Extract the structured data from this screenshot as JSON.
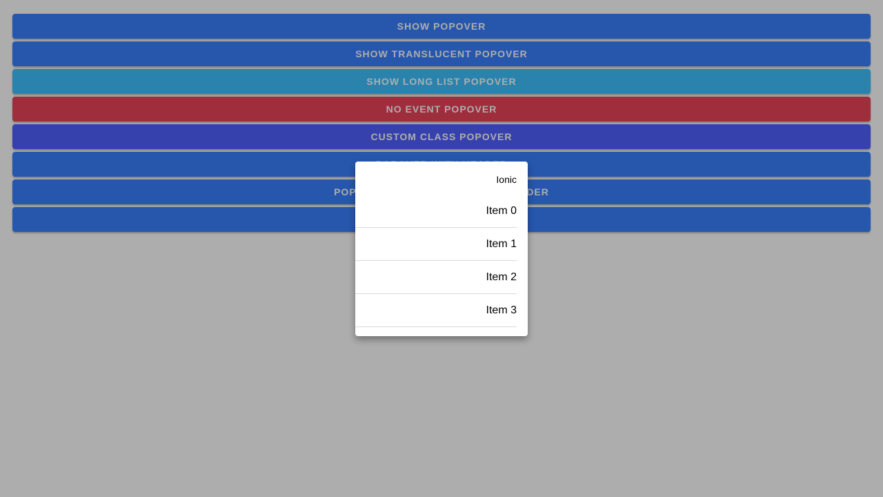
{
  "buttons": [
    {
      "label": "Show Popover",
      "color": "#3880ff"
    },
    {
      "label": "Show Translucent Popover",
      "color": "#3880ff"
    },
    {
      "label": "Show Long List Popover",
      "color": "#3dc2ff"
    },
    {
      "label": "No Event Popover",
      "color": "#eb445a"
    },
    {
      "label": "Custom Class Popover",
      "color": "#5260ff"
    },
    {
      "label": "Popover With Header",
      "color": "#3880ff"
    },
    {
      "label": "Popover With Translucent Header",
      "color": "#3880ff"
    },
    {
      "label": "",
      "color": "#3880ff"
    }
  ],
  "popover": {
    "header": "Ionic",
    "items": [
      "Item 0",
      "Item 1",
      "Item 2",
      "Item 3"
    ]
  },
  "colors": {
    "backdrop": "rgba(0,0,0,0.32)",
    "popover_bg": "#ffffff"
  }
}
